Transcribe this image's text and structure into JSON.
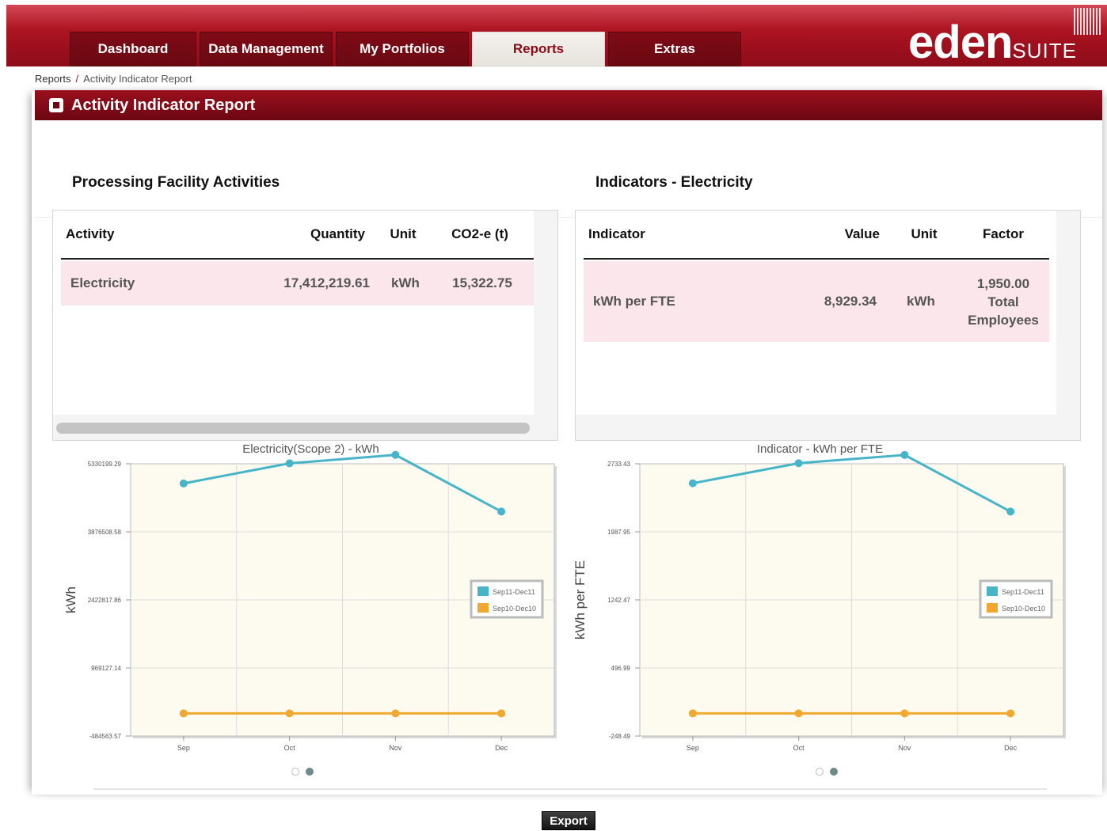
{
  "nav": {
    "tabs": [
      {
        "label": "Dashboard"
      },
      {
        "label": "Data Management"
      },
      {
        "label": "My Portfolios"
      },
      {
        "label": "Reports"
      },
      {
        "label": "Extras"
      }
    ],
    "active_tab": "Reports",
    "logo_main": "eden",
    "logo_suffix": "SUITE"
  },
  "breadcrumb": {
    "root": "Reports",
    "separator": "/",
    "current": "Activity Indicator Report"
  },
  "panel": {
    "title": "Activity Indicator Report"
  },
  "activities": {
    "title": "Processing Facility Activities",
    "headers": {
      "activity": "Activity",
      "quantity": "Quantity",
      "unit": "Unit",
      "co2": "CO2-e (t)"
    },
    "rows": [
      {
        "activity": "Electricity",
        "quantity": "17,412,219.61",
        "unit": "kWh",
        "co2": "15,322.75"
      }
    ]
  },
  "indicators": {
    "title": "Indicators - Electricity",
    "headers": {
      "indicator": "Indicator",
      "value": "Value",
      "unit": "Unit",
      "factor": "Factor"
    },
    "rows": [
      {
        "indicator": "kWh per FTE",
        "value": "8,929.34",
        "unit": "kWh",
        "factor_line1": "1,950.00",
        "factor_line2": "Total",
        "factor_line3": "Employees"
      }
    ]
  },
  "colors": {
    "series1": "#48b4c8",
    "series2": "#f0a830",
    "brand": "#a4111f"
  },
  "chart_data": [
    {
      "type": "line",
      "title": "Electricity(Scope 2) - kWh",
      "ylabel": "kWh",
      "xlabel": "",
      "categories": [
        "Sep",
        "Oct",
        "Nov",
        "Dec"
      ],
      "ytick_labels": [
        "5330199.29",
        "3876508.58",
        "2422817.86",
        "969127.14",
        "-484563.57"
      ],
      "ylim": [
        -484563.57,
        5330199.29
      ],
      "grid": true,
      "legend": "right",
      "series": [
        {
          "name": "Sep11-Dec11",
          "values": [
            4910000,
            5340000,
            5520000,
            4310000
          ]
        },
        {
          "name": "Sep10-Dec10",
          "values": [
            0,
            0,
            0,
            0
          ]
        }
      ]
    },
    {
      "type": "line",
      "title": "Indicator - kWh per FTE",
      "ylabel": "kWh per FTE",
      "xlabel": "",
      "categories": [
        "Sep",
        "Oct",
        "Nov",
        "Dec"
      ],
      "ytick_labels": [
        "2733.43",
        "1987.95",
        "1242.47",
        "496.99",
        "-248.49"
      ],
      "ylim": [
        -248.49,
        2733.43
      ],
      "grid": true,
      "legend": "right",
      "series": [
        {
          "name": "Sep11-Dec11",
          "values": [
            2520,
            2740,
            2830,
            2210
          ]
        },
        {
          "name": "Sep10-Dec10",
          "values": [
            0,
            0,
            0,
            0
          ]
        }
      ]
    }
  ],
  "footer": {
    "export_label": "Export"
  }
}
